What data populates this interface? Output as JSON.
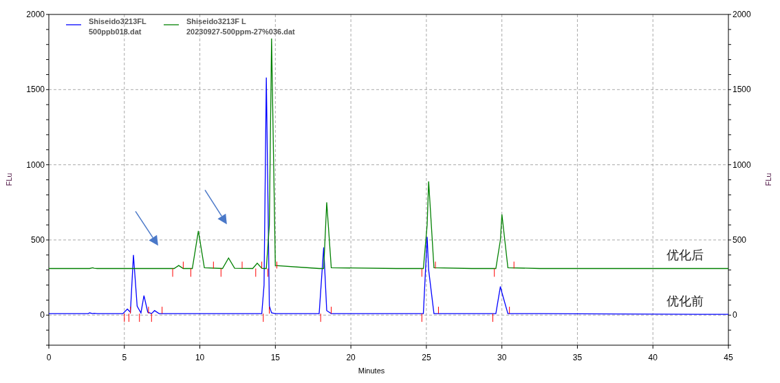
{
  "chart_data": {
    "type": "line",
    "xlabel": "Minutes",
    "ylabel": "FLu",
    "y2label": "FLu",
    "xlim": [
      0,
      45
    ],
    "ylim": [
      -200,
      2000
    ],
    "y2lim": [
      -200,
      2000
    ],
    "xticks": [
      0,
      5,
      10,
      15,
      20,
      25,
      30,
      35,
      40,
      45
    ],
    "yticks": [
      0,
      500,
      1000,
      1500,
      2000
    ],
    "y2ticks": [
      0,
      500,
      1000,
      1500,
      2000
    ],
    "grid": true,
    "legend": true,
    "x": [
      0,
      2.6,
      2.7,
      2.9,
      3.0,
      3.2,
      4.9,
      5.2,
      5.4,
      5.6,
      5.85,
      6.1,
      6.3,
      6.55,
      6.8,
      7.0,
      7.3,
      8.3,
      8.6,
      8.9,
      9.5,
      9.9,
      10.3,
      11.5,
      11.9,
      12.3,
      13.5,
      13.8,
      14.1,
      14.25,
      14.4,
      14.6,
      14.75,
      15.0,
      17.9,
      18.2,
      18.4,
      18.7,
      23.0,
      24.8,
      25.05,
      25.15,
      25.5,
      28.0,
      29.6,
      29.9,
      30.0,
      30.4,
      32.5,
      45
    ],
    "series": [
      {
        "name": "Shiseido3213FL\n500ppb018.dat",
        "color": "#0000ff",
        "values": [
          10,
          10,
          15,
          10,
          12,
          10,
          10,
          40,
          20,
          400,
          60,
          15,
          130,
          20,
          10,
          30,
          10,
          10,
          10,
          10,
          10,
          10,
          10,
          10,
          10,
          10,
          10,
          10,
          10,
          200,
          1580,
          60,
          15,
          10,
          10,
          450,
          30,
          10,
          10,
          10,
          520,
          300,
          10,
          10,
          10,
          190,
          150,
          10,
          10,
          5
        ]
      },
      {
        "name": "Shiseido3213F L\n20230927-500ppm-27%036.dat",
        "color": "#008000",
        "values": [
          310,
          310,
          310,
          315,
          312,
          310,
          310,
          310,
          310,
          310,
          310,
          310,
          310,
          310,
          310,
          310,
          310,
          310,
          330,
          310,
          310,
          560,
          315,
          310,
          380,
          312,
          310,
          345,
          312,
          310,
          310,
          600,
          1840,
          330,
          310,
          310,
          750,
          315,
          310,
          310,
          600,
          890,
          315,
          310,
          310,
          500,
          670,
          315,
          310,
          310
        ]
      }
    ],
    "annotations": [
      "优化后",
      "优化前"
    ]
  }
}
